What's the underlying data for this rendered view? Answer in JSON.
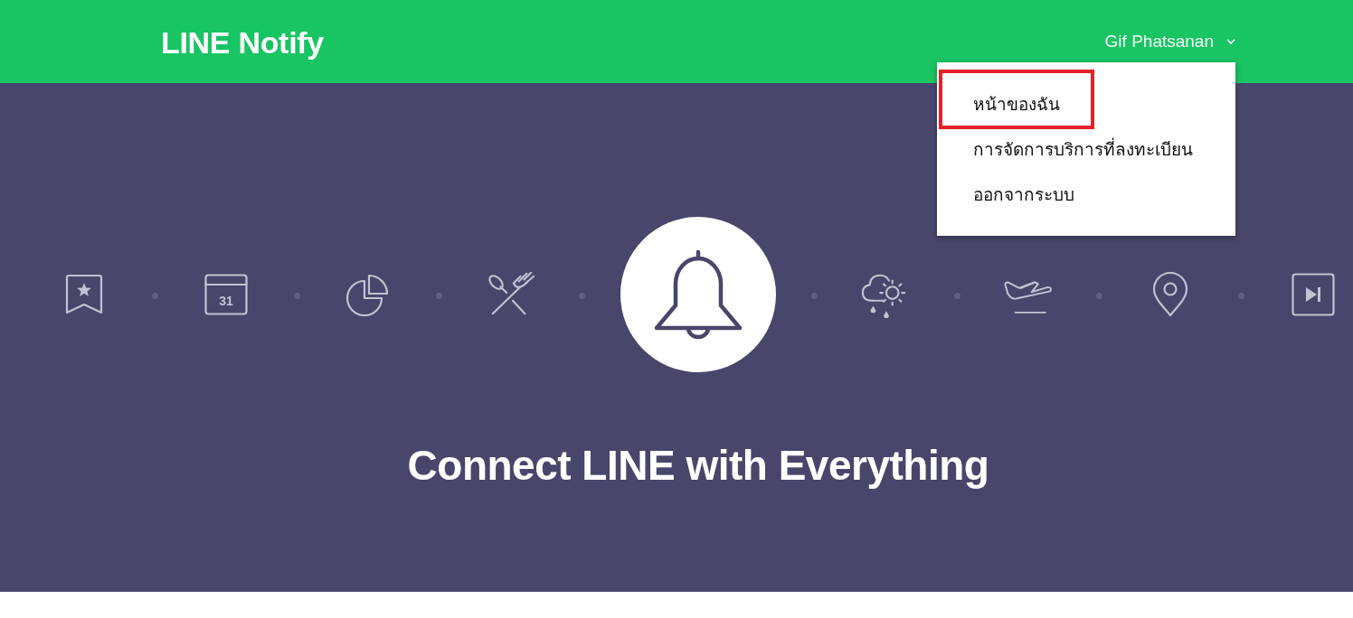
{
  "header": {
    "logo": "LINE Notify",
    "user_name": "Gif Phatsanan"
  },
  "account_menu": {
    "open": true,
    "items": [
      {
        "label": "หน้าของฉัน",
        "highlighted": true
      },
      {
        "label": "การจัดการบริการที่ลงทะเบียน",
        "highlighted": false
      },
      {
        "label": "ออกจากระบบ",
        "highlighted": false
      }
    ]
  },
  "hero": {
    "calendar_day": "31",
    "title": "Connect LINE with Everything"
  }
}
